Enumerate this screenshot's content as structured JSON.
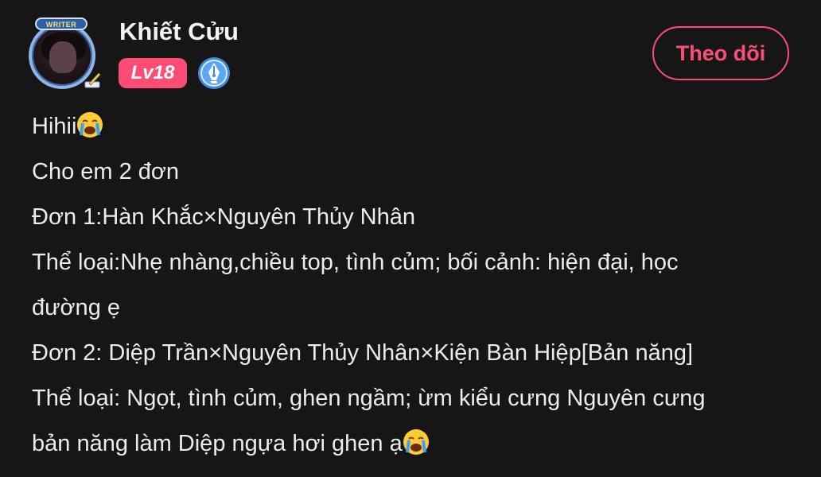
{
  "author": {
    "name": "Khiết Cửu",
    "level": "Lv18",
    "avatar_badge": "WRITER",
    "avatar_icon": "writer-avatar-icon",
    "writer_badge_icon": "fountain-pen-icon"
  },
  "actions": {
    "follow_label": "Theo dõi"
  },
  "post": {
    "lines": [
      "Hihii",
      "Cho em 2 đơn",
      "Đơn 1:Hàn Khắc×Nguyên Thủy Nhân",
      "Thể loại:Nhẹ nhàng,chiều top, tình củm; bối cảnh: hiện đại, học",
      "đường ẹ",
      "Đơn 2: Diệp Trần×Nguyên Thủy Nhân×Kiện Bàn Hiệp[Bản năng]",
      "Thể loại: Ngọt, tình củm, ghen ngầm; ừm kiểu cưng Nguyên cưng",
      "bản năng làm Diệp ngựa hơi ghen ạ"
    ],
    "emoji_icon": "crying-face-icon"
  },
  "colors": {
    "background": "#161616",
    "accent": "#ff4c75",
    "text": "#ececec",
    "writer_blue": "#3d8be0"
  }
}
